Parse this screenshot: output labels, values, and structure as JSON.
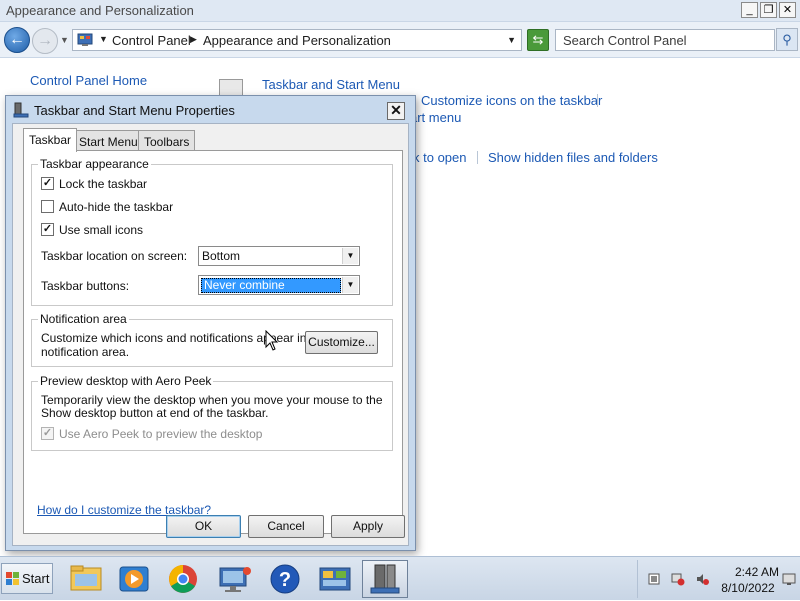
{
  "window": {
    "title": "Appearance and Personalization",
    "breadcrumb": [
      "Control Panel",
      "Appearance and Personalization"
    ],
    "search_placeholder": "Search Control Panel"
  },
  "background": {
    "control_panel_home": "Control Panel Home",
    "taskbar_and_start_menu": "Taskbar and Start Menu",
    "customize_icons": "Customize icons on the taskbar",
    "start_menu_fragment": "art menu",
    "click_to_open_fragment": "k to open",
    "show_hidden_files": "Show hidden files and folders"
  },
  "dialog": {
    "title": "Taskbar and Start Menu Properties",
    "tabs": [
      "Taskbar",
      "Start Menu",
      "Toolbars"
    ],
    "taskbar_appearance": {
      "title": "Taskbar appearance",
      "lock_taskbar": "Lock the taskbar",
      "lock_taskbar_checked": true,
      "auto_hide": "Auto-hide the taskbar",
      "auto_hide_checked": false,
      "small_icons": "Use small icons",
      "small_icons_checked": true,
      "location_label": "Taskbar location on screen:",
      "location_value": "Bottom",
      "buttons_label": "Taskbar buttons:",
      "buttons_value": "Never combine"
    },
    "notification_area": {
      "title": "Notification area",
      "description_line1": "Customize which icons and notifications appear in the",
      "description_line2": "notification area.",
      "customize_button": "Customize..."
    },
    "aero_peek": {
      "title": "Preview desktop with Aero Peek",
      "description_line1": "Temporarily view the desktop when you move your mouse to the",
      "description_line2": "Show desktop button at end of the taskbar.",
      "use_aero_peek": "Use Aero Peek to preview the desktop",
      "use_aero_peek_checked": true
    },
    "help_link": "How do I customize the taskbar?",
    "ok": "OK",
    "cancel": "Cancel",
    "apply": "Apply"
  },
  "taskbar": {
    "start_label": "Start",
    "pinned": [
      "file-explorer-icon",
      "media-player-icon",
      "chrome-icon",
      "remote-desktop-icon",
      "help-icon",
      "control-panel-icon",
      "taskbar-properties-icon"
    ],
    "clock_time": "2:42 AM",
    "clock_date": "8/10/2022"
  },
  "colors": {
    "link": "#1c59b4",
    "selection": "#3399ff",
    "dialog_frame": "#c7d9ed"
  }
}
